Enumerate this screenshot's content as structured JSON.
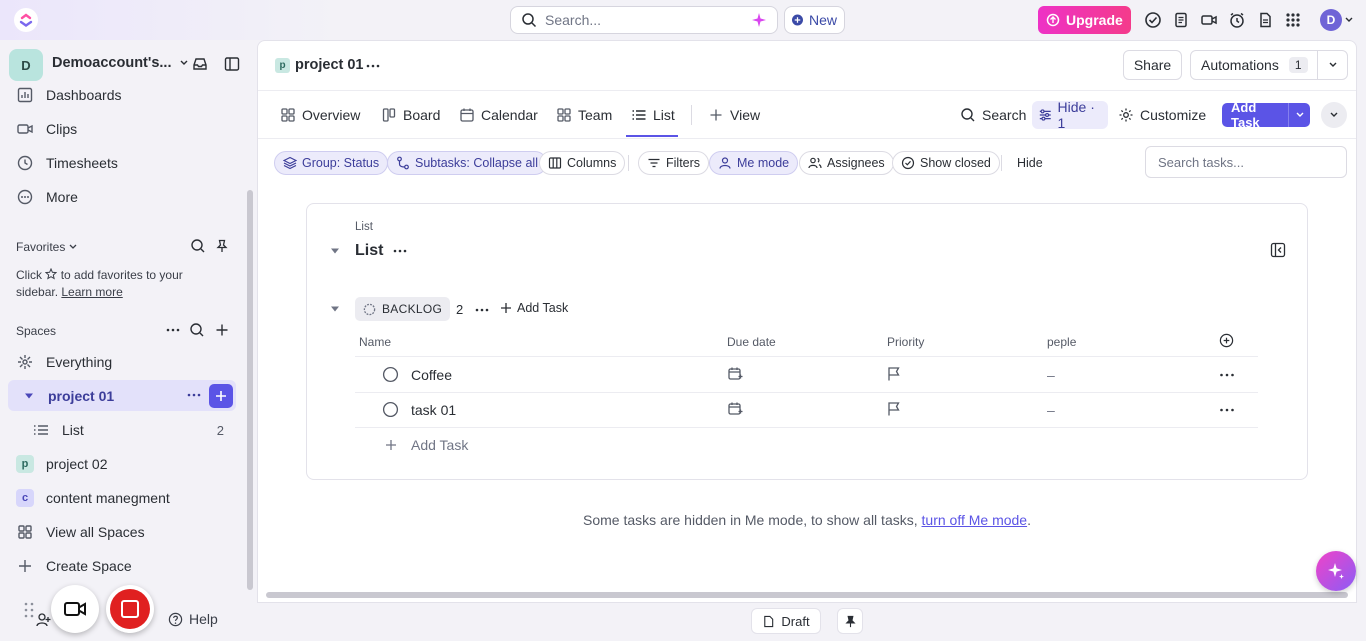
{
  "topbar": {
    "search_placeholder": "Search...",
    "new_label": "New",
    "upgrade_label": "Upgrade",
    "avatar_letter": "D"
  },
  "sidebar": {
    "workspace_letter": "D",
    "workspace_name": "Demoaccount's...",
    "nav_items": [
      {
        "label": "Dashboards",
        "icon": "dashboards-icon"
      },
      {
        "label": "Clips",
        "icon": "clips-icon"
      },
      {
        "label": "Timesheets",
        "icon": "timesheets-icon"
      },
      {
        "label": "More",
        "icon": "more-icon"
      }
    ],
    "favorites_label": "Favorites",
    "favorites_hint_1": "Click",
    "favorites_hint_2": "to add favorites to your sidebar.",
    "favorites_learn_more": "Learn more",
    "spaces_label": "Spaces",
    "everything_label": "Everything",
    "active_space": "project 01",
    "list_item_label": "List",
    "list_item_count": "2",
    "spaces": [
      {
        "letter": "p",
        "label": "project 02",
        "color": "#c9e8e2",
        "text_color": "#2d6b60"
      },
      {
        "letter": "c",
        "label": "content manegment",
        "color": "#d7d6fb",
        "text_color": "#4a47b8"
      }
    ],
    "view_all_spaces": "View all Spaces",
    "create_space": "Create Space",
    "help_label": "Help"
  },
  "main": {
    "breadcrumb_letter": "p",
    "breadcrumb_title": "project 01",
    "share_label": "Share",
    "automations_label": "Automations",
    "automations_count": "1",
    "tabs": [
      {
        "label": "Overview"
      },
      {
        "label": "Board"
      },
      {
        "label": "Calendar"
      },
      {
        "label": "Team"
      },
      {
        "label": "List"
      },
      {
        "label": "View"
      }
    ],
    "search_label": "Search",
    "hide_label": "Hide · 1",
    "customize_label": "Customize",
    "add_task_label": "Add Task",
    "chips": {
      "group": "Group: Status",
      "subtasks": "Subtasks: Collapse all",
      "columns": "Columns",
      "filters": "Filters",
      "me_mode": "Me mode",
      "assignees": "Assignees",
      "show_closed": "Show closed",
      "hide": "Hide"
    },
    "search_tasks_placeholder": "Search tasks..."
  },
  "list": {
    "breadcrumb": "List",
    "title": "List",
    "status_label": "BACKLOG",
    "status_count": "2",
    "add_task_inline": "Add Task",
    "columns": [
      "Name",
      "Due date",
      "Priority",
      "peple"
    ],
    "tasks": [
      {
        "name": "Coffee",
        "people": "–"
      },
      {
        "name": "task 01",
        "people": "–"
      }
    ],
    "add_task_row": "Add Task",
    "footer_note": "Some tasks are hidden in Me mode, to show all tasks,",
    "footer_link": "turn off Me mode",
    "footer_end": "."
  },
  "bottom": {
    "draft_label": "Draft"
  },
  "colors": {
    "accent": "#5b54e6",
    "active_bg": "#e3e1fa",
    "upgrade": "#ee32c6"
  }
}
